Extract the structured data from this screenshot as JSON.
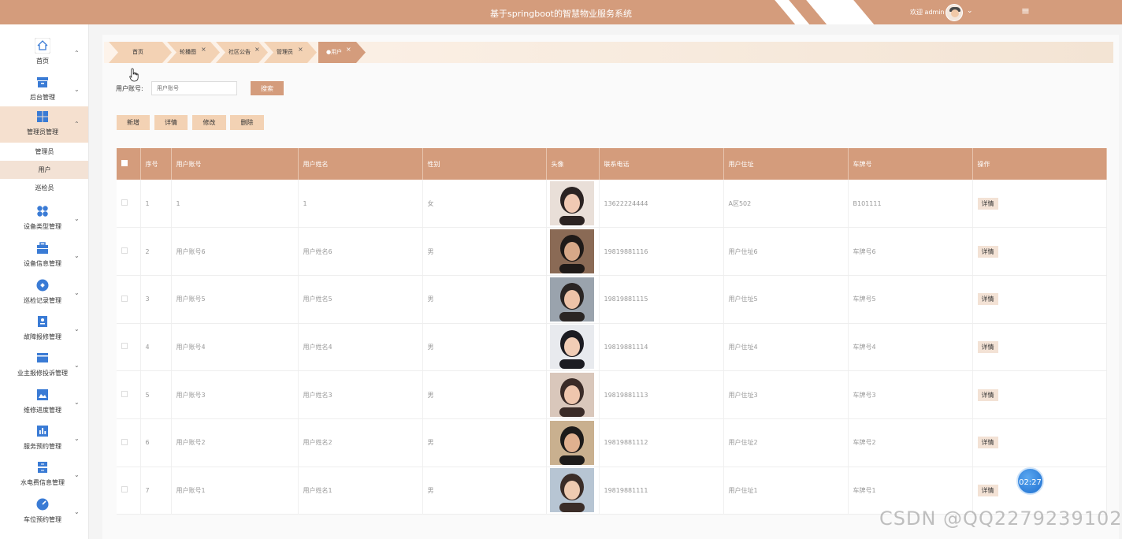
{
  "header": {
    "title": "基于springboot的智慧物业服务系统",
    "welcome": "欢迎 admin",
    "colors": {
      "primary": "#d49c7c",
      "light": "#f3d2b4"
    }
  },
  "sidebar": {
    "items": [
      {
        "label": "首页",
        "icon": "home-icon",
        "expanded": true
      },
      {
        "label": "后台管理",
        "icon": "archive-icon"
      },
      {
        "label": "管理员管理",
        "icon": "grid-icon",
        "expanded": true
      },
      {
        "label": "设备类型管理",
        "icon": "dots-icon"
      },
      {
        "label": "设备信息管理",
        "icon": "briefcase-icon"
      },
      {
        "label": "巡检记录管理",
        "icon": "target-icon"
      },
      {
        "label": "故障报修管理",
        "icon": "id-badge-icon"
      },
      {
        "label": "业主报修投诉管理",
        "icon": "card-icon"
      },
      {
        "label": "维修进度管理",
        "icon": "picture-icon"
      },
      {
        "label": "服务预约管理",
        "icon": "bar-chart-icon"
      },
      {
        "label": "水电费信息管理",
        "icon": "server-icon"
      },
      {
        "label": "车位预约管理",
        "icon": "gauge-icon"
      }
    ],
    "submenu": [
      "管理员",
      "用户",
      "巡检员"
    ]
  },
  "tabs": [
    {
      "label": "首页",
      "closable": false
    },
    {
      "label": "轮播图",
      "closable": true
    },
    {
      "label": "社区公告",
      "closable": true
    },
    {
      "label": "管理员",
      "closable": true
    },
    {
      "label": "●用户",
      "closable": true,
      "active": true
    }
  ],
  "search": {
    "label": "用户账号:",
    "placeholder": "用户账号",
    "button": "搜索"
  },
  "actions": [
    "新增",
    "详情",
    "修改",
    "删除"
  ],
  "table": {
    "headers": [
      "序号",
      "用户账号",
      "用户姓名",
      "性别",
      "头像",
      "联系电话",
      "用户住址",
      "车牌号",
      "操作"
    ],
    "rows": [
      {
        "no": "1",
        "account": "1",
        "name": "1",
        "gender": "女",
        "phone": "13622224444",
        "address": "A区502",
        "plate": "B101111",
        "action": "详情"
      },
      {
        "no": "2",
        "account": "用户账号6",
        "name": "用户姓名6",
        "gender": "男",
        "phone": "19819881116",
        "address": "用户住址6",
        "plate": "车牌号6",
        "action": "详情"
      },
      {
        "no": "3",
        "account": "用户账号5",
        "name": "用户姓名5",
        "gender": "男",
        "phone": "19819881115",
        "address": "用户住址5",
        "plate": "车牌号5",
        "action": "详情"
      },
      {
        "no": "4",
        "account": "用户账号4",
        "name": "用户姓名4",
        "gender": "男",
        "phone": "19819881114",
        "address": "用户住址4",
        "plate": "车牌号4",
        "action": "详情"
      },
      {
        "no": "5",
        "account": "用户账号3",
        "name": "用户姓名3",
        "gender": "男",
        "phone": "19819881113",
        "address": "用户住址3",
        "plate": "车牌号3",
        "action": "详情"
      },
      {
        "no": "6",
        "account": "用户账号2",
        "name": "用户姓名2",
        "gender": "男",
        "phone": "19819881112",
        "address": "用户住址2",
        "plate": "车牌号2",
        "action": "详情"
      },
      {
        "no": "7",
        "account": "用户账号1",
        "name": "用户姓名1",
        "gender": "男",
        "phone": "19819881111",
        "address": "用户住址1",
        "plate": "车牌号1",
        "action": "详情"
      }
    ]
  },
  "timer": "02:27",
  "watermark": "CSDN @QQ2279239102"
}
